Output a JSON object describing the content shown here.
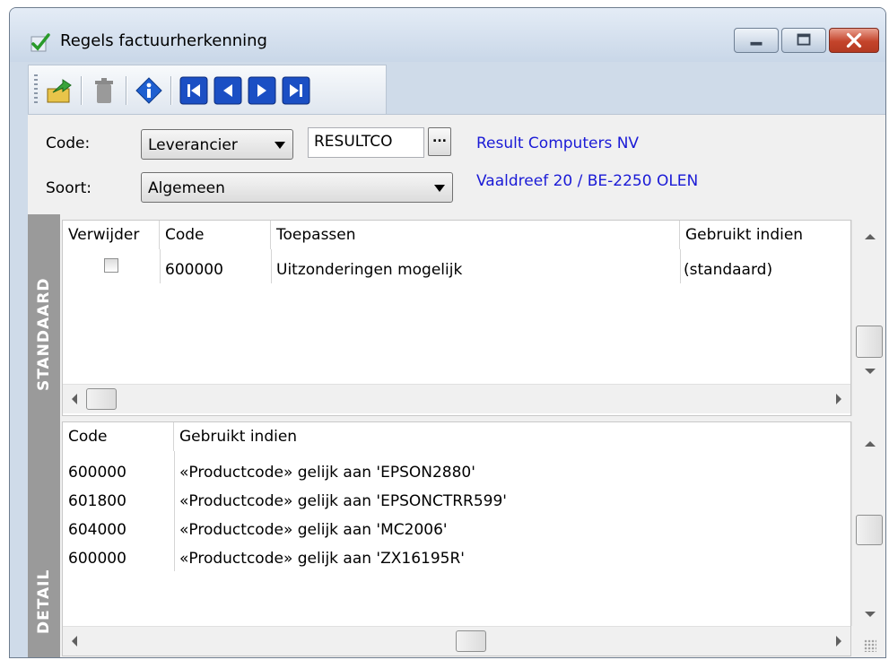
{
  "window": {
    "title": "Regels factuurherkenning",
    "title_icon": "check-icon",
    "controls": [
      "minimize-icon",
      "maximize-icon",
      "close-icon"
    ]
  },
  "toolbar": {
    "buttons": [
      {
        "icon": "export-icon",
        "enabled": true
      },
      {
        "icon": "delete-icon",
        "enabled": false
      },
      {
        "icon": "info-icon",
        "enabled": true
      },
      {
        "icon": "first-record-icon",
        "enabled": true
      },
      {
        "icon": "previous-record-icon",
        "enabled": true
      },
      {
        "icon": "next-record-icon",
        "enabled": true
      },
      {
        "icon": "last-record-icon",
        "enabled": true
      }
    ]
  },
  "header": {
    "code_label": "Code:",
    "code_type": "Leverancier",
    "code_value": "RESULTCO",
    "ellipsis": "...",
    "soort_label": "Soort:",
    "soort_value": "Algemeen",
    "supplier_name": "Result Computers NV",
    "supplier_address": "Vaaldreef 20 / BE-2250 OLEN"
  },
  "standaard": {
    "section_label": "STANDAARD",
    "columns": [
      "Verwijder",
      "Code",
      "Toepassen",
      "Gebruikt indien"
    ],
    "rows": [
      {
        "verwijder": false,
        "code": "600000",
        "toepassen": "Uitzonderingen mogelijk",
        "gebruikt_indien": "(standaard)"
      }
    ]
  },
  "detail": {
    "section_label": "DETAIL",
    "columns": [
      "Code",
      "Gebruikt indien"
    ],
    "rows": [
      {
        "code": "600000",
        "gebruikt_indien": "«Productcode» gelijk aan 'EPSON2880'"
      },
      {
        "code": "601800",
        "gebruikt_indien": "«Productcode» gelijk aan 'EPSONCTRR599'"
      },
      {
        "code": "604000",
        "gebruikt_indien": "«Productcode» gelijk aan 'MC2006'"
      },
      {
        "code": "600000",
        "gebruikt_indien": "«Productcode» gelijk aan 'ZX16195R'"
      }
    ]
  },
  "colors": {
    "link": "#1a1ad6",
    "sidebar": "#9a9a9a",
    "window_frame": "#cfdbe9",
    "close_button": "#c4442b"
  }
}
